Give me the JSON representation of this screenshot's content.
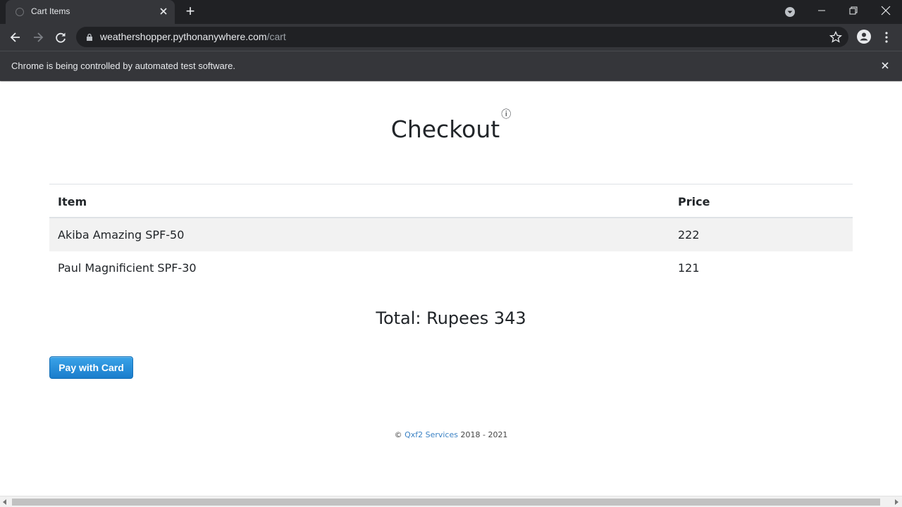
{
  "browser": {
    "tab_title": "Cart Items",
    "new_tab_symbol": "+",
    "url_host": "weathershopper.pythonanywhere.com",
    "url_path": "/cart",
    "infobar_text": "Chrome is being controlled by automated test software."
  },
  "page": {
    "title": "Checkout",
    "title_sup": "ⓘ",
    "table": {
      "headers": [
        "Item",
        "Price"
      ],
      "rows": [
        {
          "item": "Akiba Amazing SPF-50",
          "price": "222"
        },
        {
          "item": "Paul Magnificient SPF-30",
          "price": "121"
        }
      ]
    },
    "total": "Total: Rupees 343",
    "pay_button": "Pay with Card",
    "footer": {
      "copyright": "©",
      "company": "Qxf2 Services",
      "years": "2018 - 2021"
    }
  },
  "colors": {
    "chrome_dark": "#202124",
    "chrome_toolbar": "#35363a",
    "pay_button": "#1a7dcc",
    "link": "#3b82c4"
  },
  "icons": [
    "back-icon",
    "forward-icon",
    "reload-icon",
    "lock-icon",
    "star-icon",
    "profile-icon",
    "menu-icon",
    "close-icon",
    "minimize-icon",
    "maximize-icon",
    "tab-search-icon"
  ]
}
